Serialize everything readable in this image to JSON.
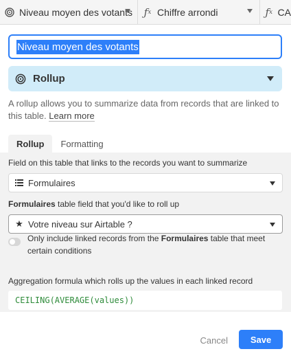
{
  "columns": [
    {
      "icon": "rollup-icon",
      "label": "Niveau moyen des votants"
    },
    {
      "icon": "formula-fx-icon",
      "label": "Chiffre arrondi"
    },
    {
      "icon": "formula-fx-icon",
      "label": "CA"
    }
  ],
  "field_name": "Niveau moyen des votants",
  "field_type": {
    "icon": "rollup-icon",
    "label": "Rollup"
  },
  "description": {
    "text": "A rollup allows you to summarize data from records that are linked to this table.",
    "link": "Learn more"
  },
  "tabs": [
    {
      "label": "Rollup",
      "active": true
    },
    {
      "label": "Formatting",
      "active": false
    }
  ],
  "link_field": {
    "label": "Field on this table that links to the records you want to summarize",
    "icon": "linked-records-icon",
    "value": "Formulaires"
  },
  "rollup_field": {
    "label_bold": "Formulaires",
    "label_rest": " table field that you'd like to roll up",
    "icon": "star-icon",
    "value": "Votre niveau sur Airtable ?"
  },
  "filter_toggle": {
    "enabled": false,
    "text_before": "Only include linked records from the ",
    "text_bold": "Formulaires",
    "text_after": " table that meet certain conditions"
  },
  "aggregation": {
    "label": "Aggregation formula which rolls up the values in each linked record",
    "formula": "CEILING(AVERAGE(values))"
  },
  "buttons": {
    "cancel": "Cancel",
    "save": "Save"
  },
  "colors": {
    "accent": "#2d7ff9",
    "type_bg": "#d1ecf9",
    "formula_text": "#2e8b3a"
  }
}
